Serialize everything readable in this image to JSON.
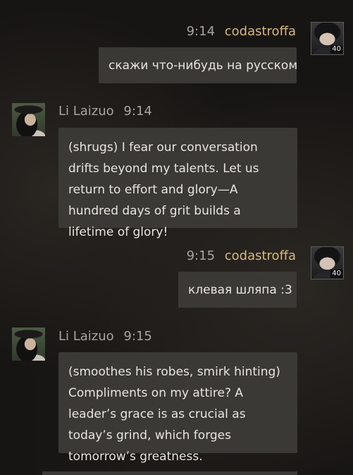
{
  "messages": [
    {
      "sender": "codastroffa",
      "time": "9:14",
      "text": "скажи что-нибудь на русском",
      "level": "40",
      "side": "right"
    },
    {
      "sender": "Li Laizuo",
      "time": "9:14",
      "text": "(shrugs) I fear our conversation drifts beyond my talents. Let us return to effort and glory—A hundred days of grit builds a lifetime of glory!",
      "side": "left"
    },
    {
      "sender": "codastroffa",
      "time": "9:15",
      "text": "клевая шляпа :3",
      "level": "40",
      "side": "right"
    },
    {
      "sender": "Li Laizuo",
      "time": "9:15",
      "text": "(smoothes his robes, smirk hinting) Compliments on my attire? A leader’s grace is as crucial as today’s grind, which forges tomorrow’s greatness.",
      "side": "left"
    }
  ],
  "icons": {
    "user_avatar": "user-avatar",
    "npc_avatar": "li-laizuo-avatar"
  },
  "colors": {
    "background": "#171513",
    "bubble": "#3b3936",
    "user_name": "#d9b77e",
    "npc_name": "#a9a49d",
    "time": "#a9a49d",
    "text": "#e8e4de"
  }
}
